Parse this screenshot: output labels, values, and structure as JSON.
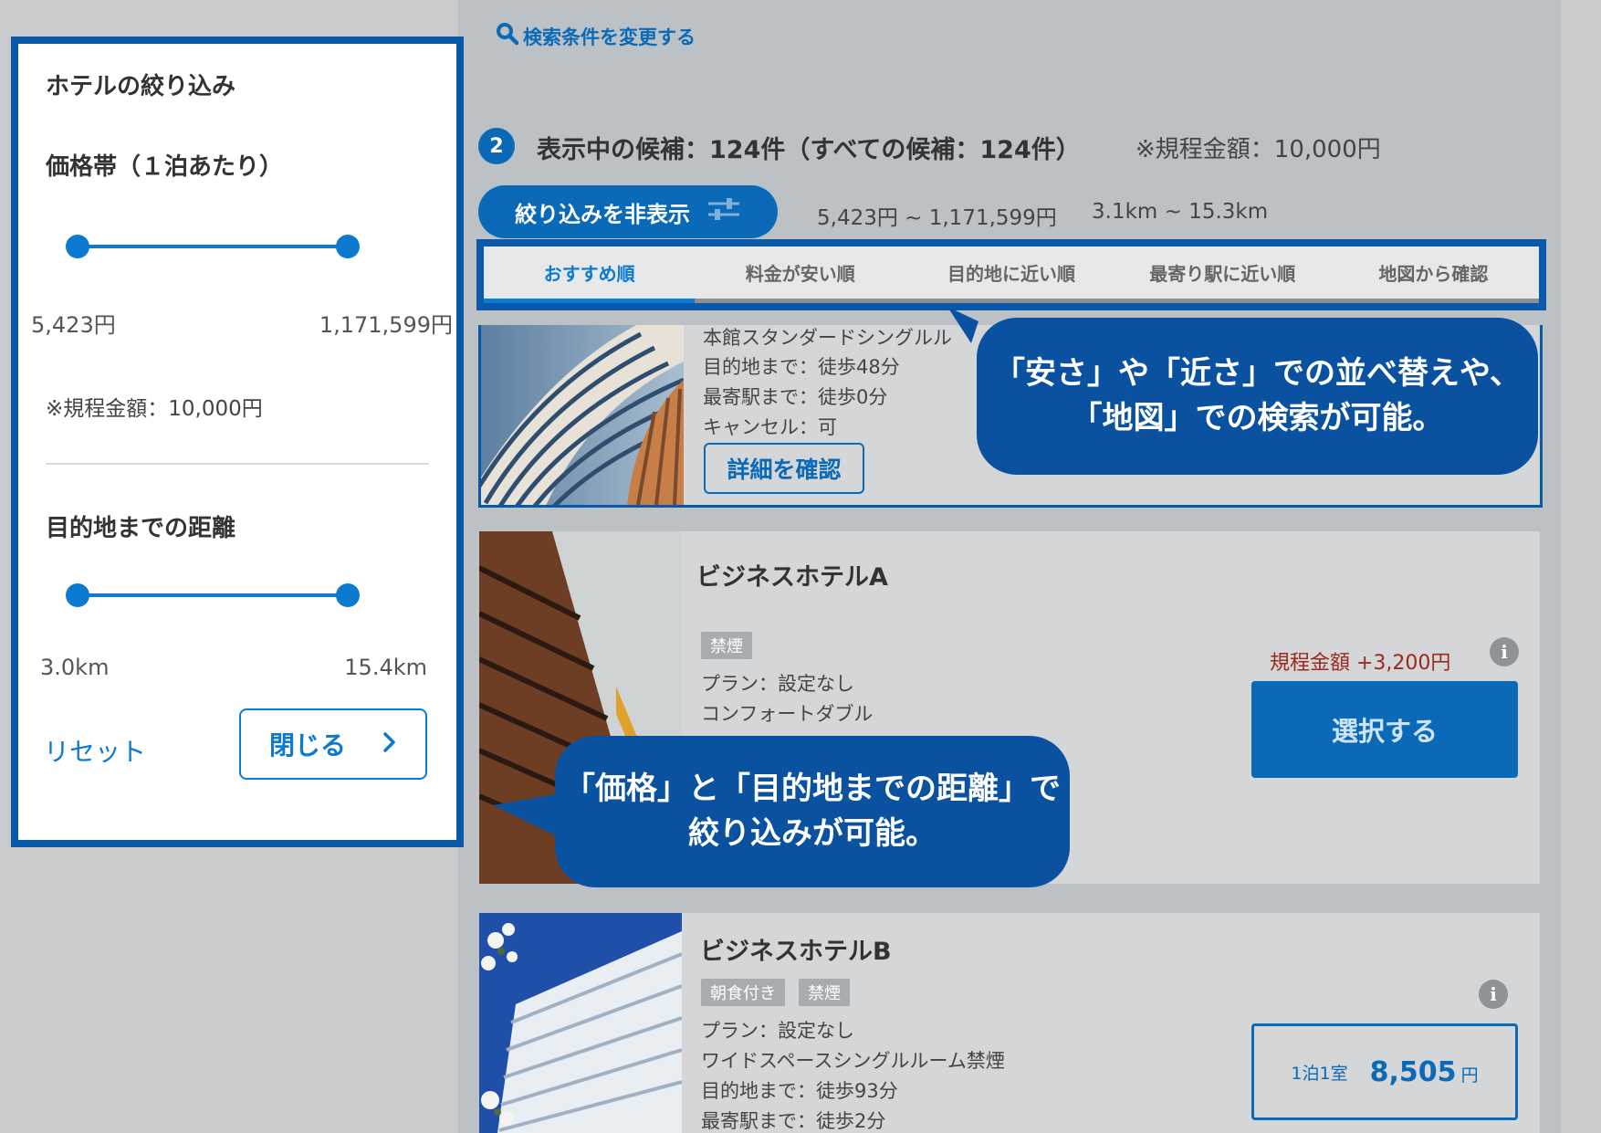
{
  "filter_panel": {
    "title": "ホテルの絞り込み",
    "price_heading": "価格帯（１泊あたり）",
    "price_min": "5,423円",
    "price_max": "1,171,599円",
    "budget_note": "※規程金額：10,000円",
    "distance_heading": "目的地までの距離",
    "distance_min": "3.0km",
    "distance_max": "15.4km",
    "reset_label": "リセット",
    "close_label": "閉じる",
    "price_range_fraction": [
      0,
      1
    ],
    "distance_range_fraction": [
      0,
      1
    ]
  },
  "header": {
    "search_link": "検索条件を変更する",
    "step_number": "2",
    "count_text": "表示中の候補：124件（すべての候補：124件）",
    "budget_text": "※規程金額：10,000円",
    "toggle_filter_label": "絞り込みを非表示",
    "price_range": "5,423円 ~ 1,171,599円",
    "distance_range": "3.1km ~ 15.3km"
  },
  "sort_tabs": [
    {
      "label": "おすすめ順",
      "active": true
    },
    {
      "label": "料金が安い順",
      "active": false
    },
    {
      "label": "目的地に近い順",
      "active": false
    },
    {
      "label": "最寄り駅に近い順",
      "active": false
    },
    {
      "label": "地図から確認",
      "active": false
    }
  ],
  "hotels": [
    {
      "room": "本館スタンダードシングルル",
      "destination": "目的地まで：徒歩48分",
      "station": "最寄駅まで：徒歩0分",
      "cancel": "キャンセル：可",
      "detail_label": "詳細を確認"
    },
    {
      "name": "ビジネスホテルA",
      "tags": [
        "禁煙"
      ],
      "plan": "プラン：設定なし",
      "room": "コンフォートダブル",
      "price_diff": "規程金額 +3,200円",
      "select_label": "選択する"
    },
    {
      "name": "ビジネスホテルB",
      "tags": [
        "朝食付き",
        "禁煙"
      ],
      "plan": "プラン：設定なし",
      "room": "ワイドスペースシングルルーム禁煙",
      "destination": "目的地まで：徒歩93分",
      "station": "最寄駅まで：徒歩2分",
      "price_unit_label": "1泊1室",
      "price_value": "8,505",
      "price_currency": "円"
    }
  ],
  "callouts": {
    "sort": {
      "line1": "「安さ」や「近さ」での並べ替えや、",
      "line2": "「地図」での検索が可能。"
    },
    "filter": {
      "line1": "「価格」と「目的地までの距離」で",
      "line2": "絞り込みが可能。"
    }
  },
  "icons": {
    "search": "search-icon",
    "sliders": "sliders-icon",
    "chevron": "chevron-right-icon",
    "info": "info-icon"
  },
  "colors": {
    "accent": "#0b6ab8",
    "highlight_border": "#0a58a8",
    "callout": "#0a52a0",
    "price_diff": "#9a2a1e"
  }
}
